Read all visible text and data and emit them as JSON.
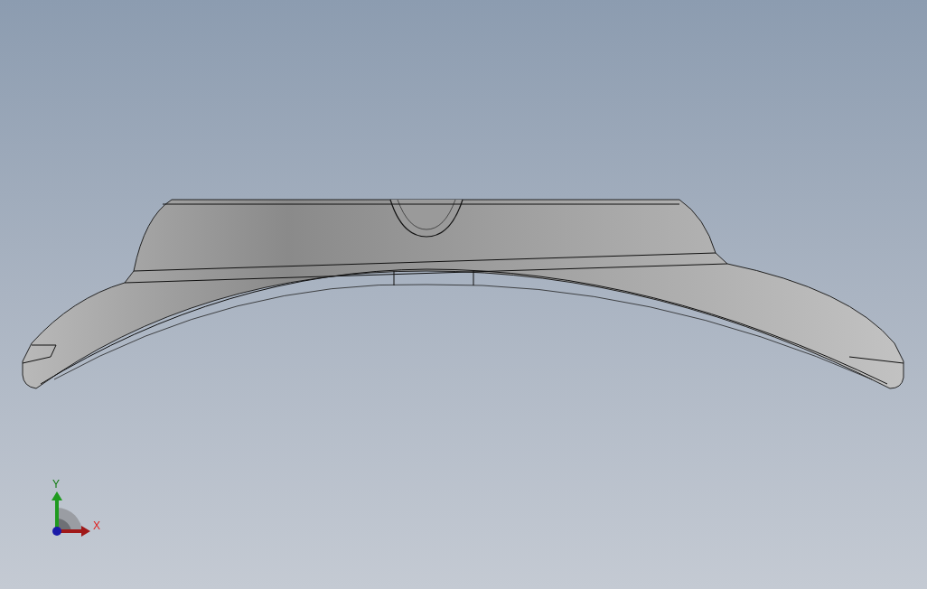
{
  "triad": {
    "y_label": "Y",
    "x_label": "X"
  }
}
